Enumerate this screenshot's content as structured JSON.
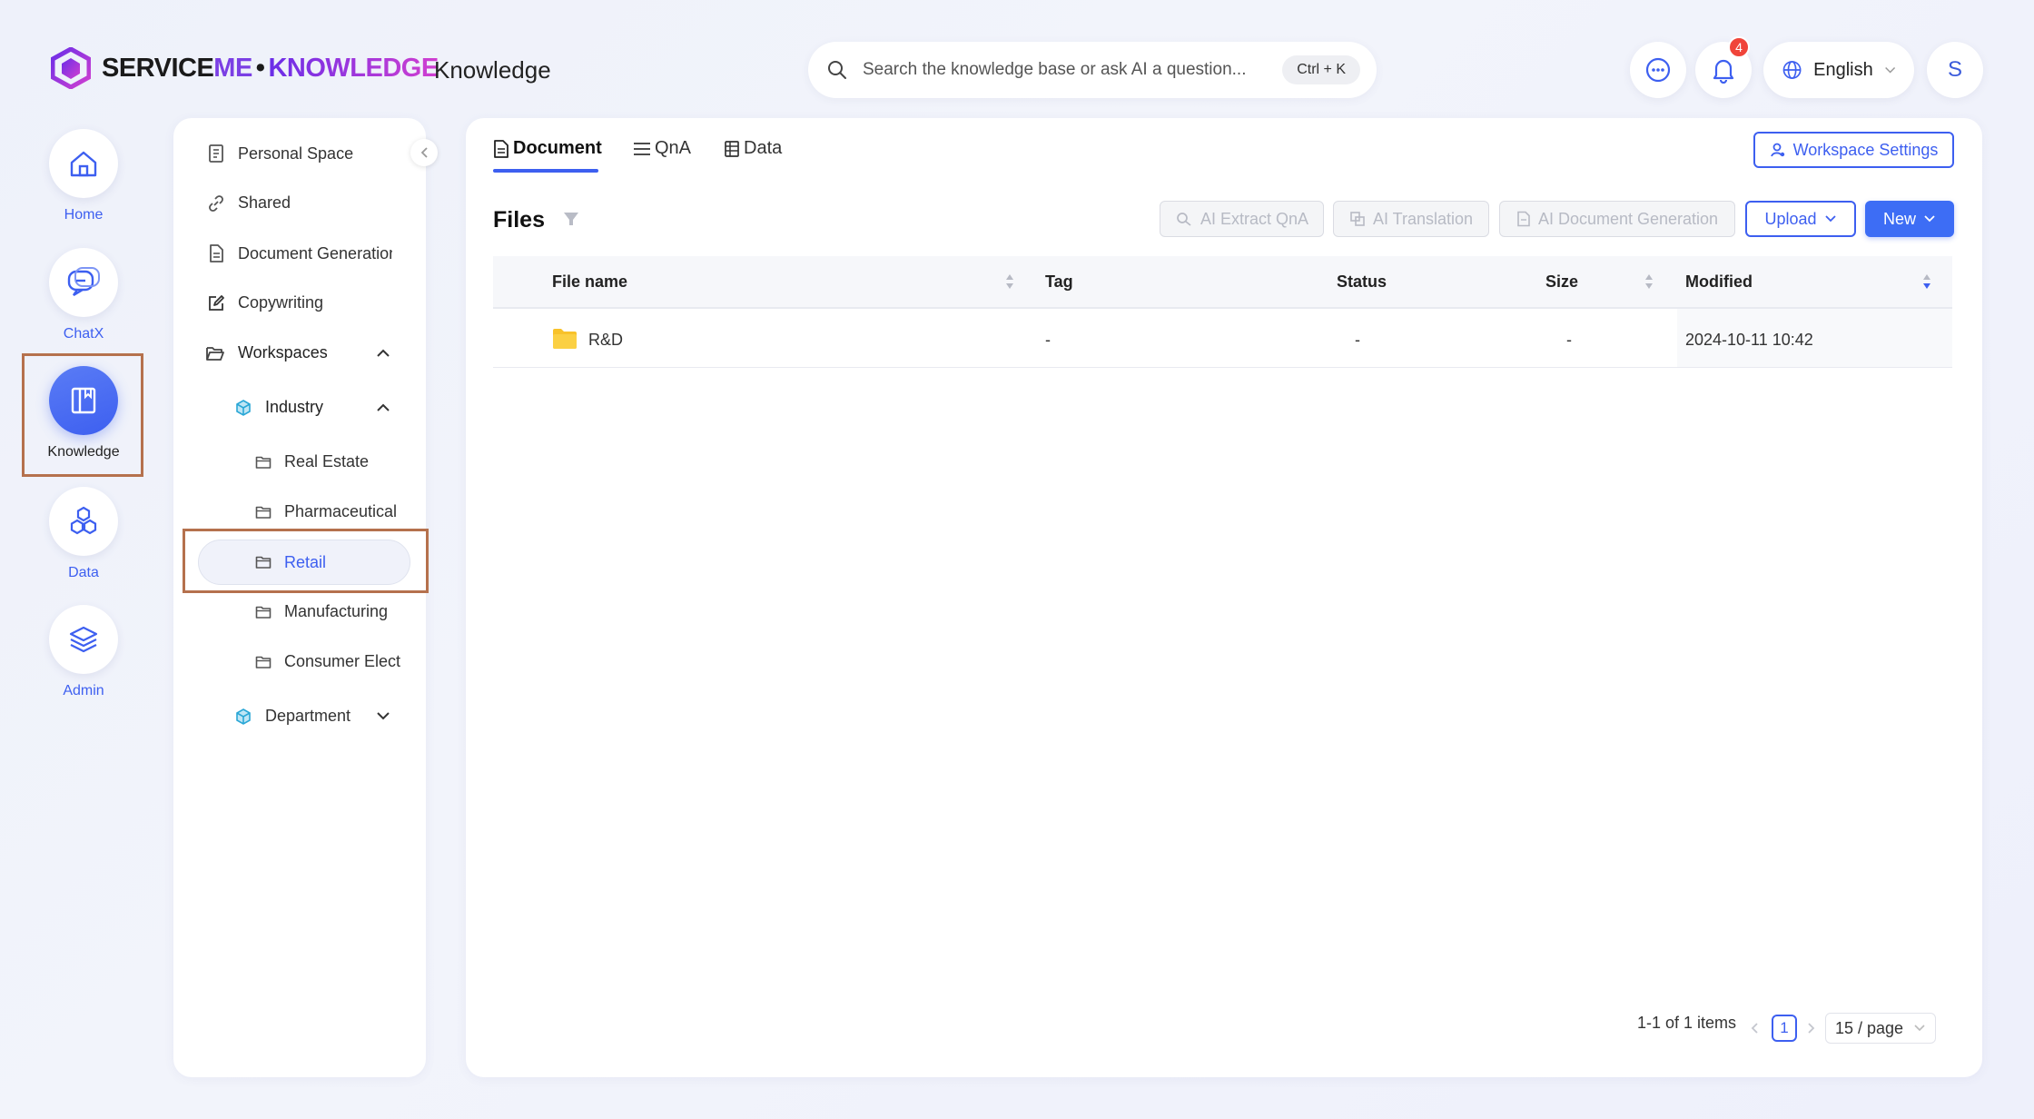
{
  "header": {
    "logo_primary": "SERVICE",
    "logo_accent": "ME",
    "logo_dot": "•",
    "logo_secondary": "KNOWLEDGE",
    "app_title": "Knowledge",
    "search_placeholder": "Search the knowledge base or ask AI a question...",
    "search_shortcut": "Ctrl + K",
    "notification_count": "4",
    "language": "English",
    "avatar_initial": "S"
  },
  "rail": {
    "items": [
      {
        "label": "Home",
        "icon": "home-icon"
      },
      {
        "label": "ChatX",
        "icon": "chat-icon"
      },
      {
        "label": "Knowledge",
        "icon": "book-icon",
        "active": true
      },
      {
        "label": "Data",
        "icon": "hexagons-icon"
      },
      {
        "label": "Admin",
        "icon": "layers-icon"
      }
    ]
  },
  "sidebar": {
    "personal_space": "Personal Space",
    "shared": "Shared",
    "document_generation": "Document Generation",
    "copywriting": "Copywriting",
    "workspaces": "Workspaces",
    "industry": "Industry",
    "industry_children": [
      "Real Estate",
      "Pharmaceutical",
      "Retail",
      "Manufacturing",
      "Consumer Elect"
    ],
    "selected": "Retail",
    "department": "Department"
  },
  "tabs": [
    "Document",
    "QnA",
    "Data"
  ],
  "active_tab": "Document",
  "workspace_settings": "Workspace Settings",
  "files_title": "Files",
  "actions": {
    "ai_extract": "AI Extract QnA",
    "ai_translation": "AI Translation",
    "ai_docgen": "AI Document Generation",
    "upload": "Upload",
    "new": "New"
  },
  "table": {
    "columns": [
      "File name",
      "Tag",
      "Status",
      "Size",
      "Modified"
    ],
    "rows": [
      {
        "name": "R&D",
        "type": "folder",
        "tag": "-",
        "status": "-",
        "size": "-",
        "modified": "2024-10-11 10:42"
      }
    ]
  },
  "pagination": {
    "summary": "1-1 of 1 items",
    "current_page": "1",
    "page_size": "15 / page"
  },
  "colors": {
    "accent": "#3d5ff0",
    "highlight_box": "#b5714d",
    "folder": "#f8c22a"
  }
}
